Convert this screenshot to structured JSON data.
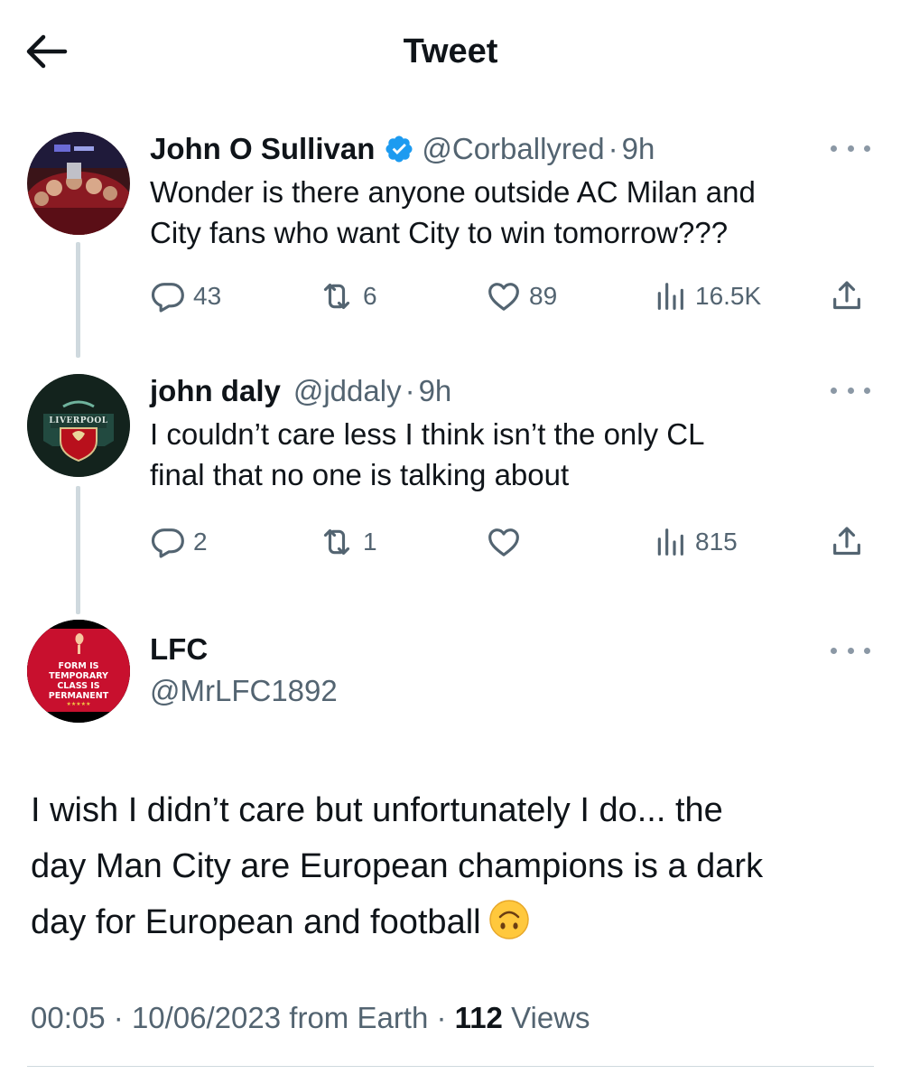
{
  "header": {
    "title": "Tweet"
  },
  "replies": [
    {
      "name": "John O Sullivan",
      "verified": true,
      "handle": "@Corballyred",
      "dot": "·",
      "time": "9h",
      "text_lines": [
        "Wonder is there anyone outside AC Milan and",
        "City fans who want City to win tomorrow???"
      ],
      "reply_count": "43",
      "retweet_count": "6",
      "like_count": "89",
      "views": "16.5K"
    },
    {
      "name": "john daly",
      "verified": false,
      "handle": "@jddaly",
      "dot": "·",
      "time": "9h",
      "text_lines": [
        "I couldn’t care less I think isn’t the only CL",
        "final that no one is talking about"
      ],
      "reply_count": "2",
      "retweet_count": "1",
      "like_count": "",
      "views": "815"
    }
  ],
  "main_tweet": {
    "name": "LFC",
    "handle": "@MrLFC1892",
    "avatar_text_line1": "FORM IS TEMPORARY",
    "avatar_text_line2": "CLASS IS PERMANENT",
    "avatar_stars": "★★★★★",
    "text_lines": [
      "I wish I didn’t care but unfortunately I do... the",
      "day Man City are European champions is a dark",
      "day for European and football"
    ],
    "emoji": "upside-down-face",
    "time": "00:05",
    "date": "10/06/2023",
    "source": "from Earth",
    "sep": "·",
    "views_count": "112",
    "views_label": "Views"
  },
  "avatar_2_label": "LIVERPOOL",
  "colors": {
    "text": "#0f1419",
    "secondary": "#536471",
    "verified": "#1d9bf0",
    "divider": "#cfd9de",
    "avatar_lfc_bg": "#c8102e"
  }
}
